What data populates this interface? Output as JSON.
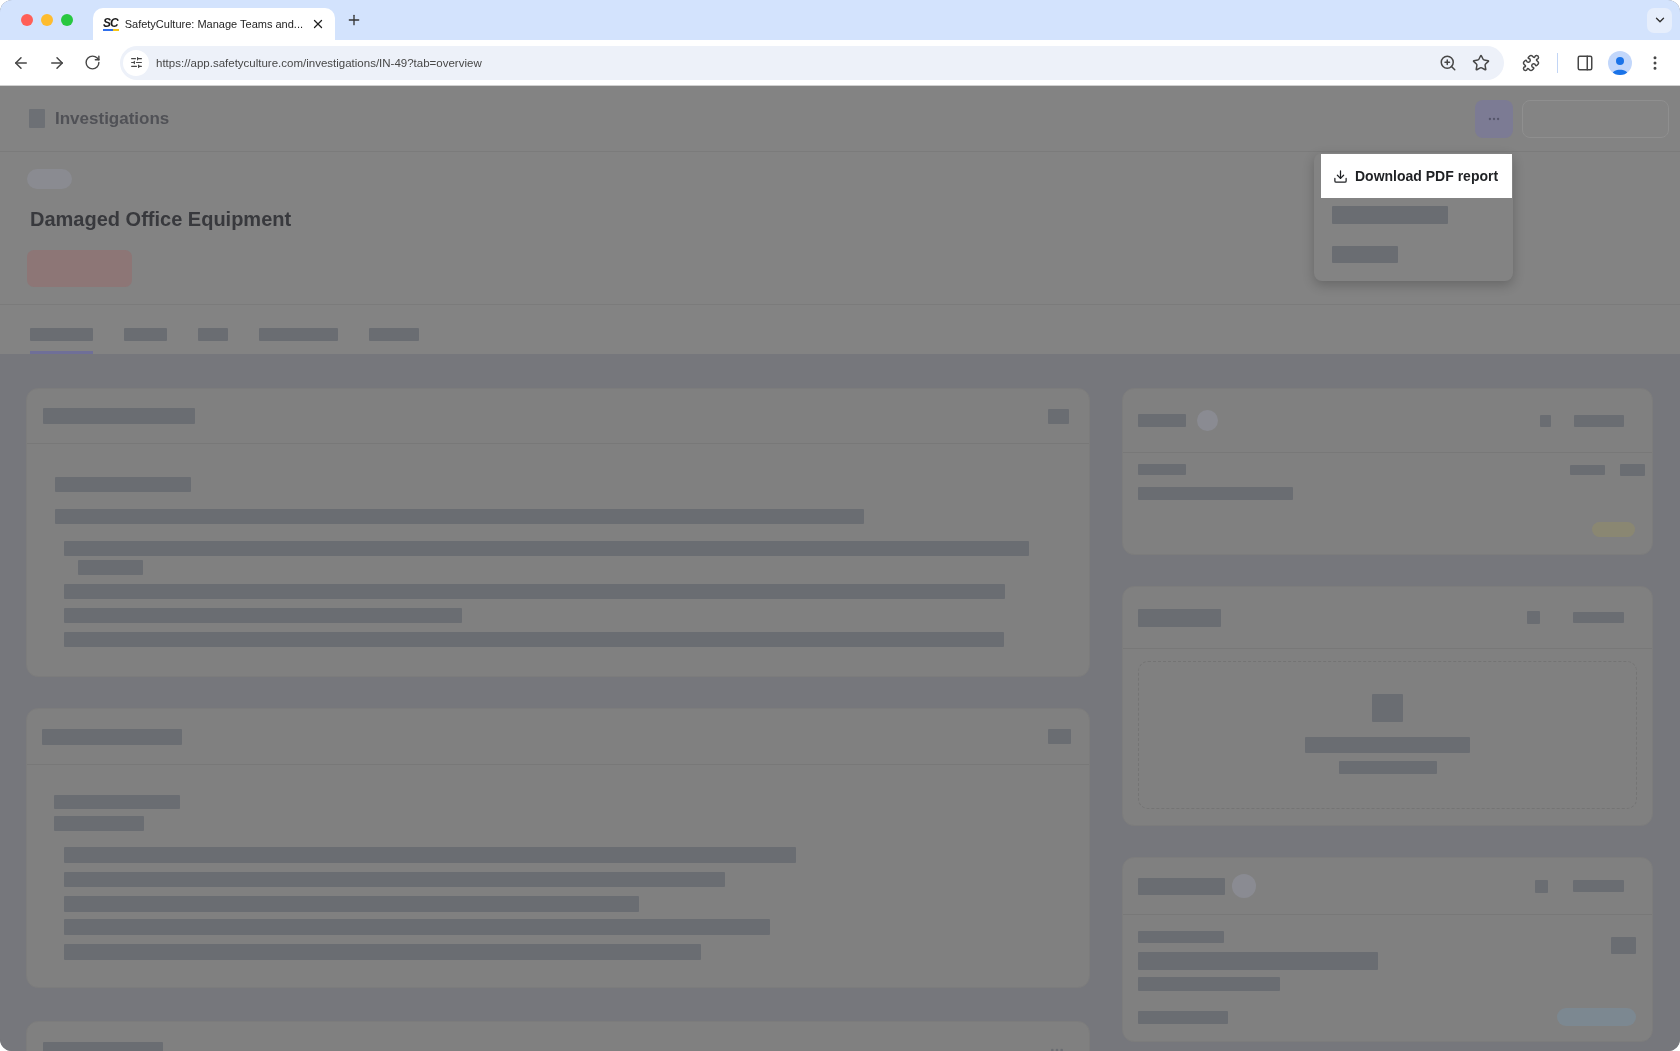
{
  "browser": {
    "tabs": [
      {
        "logo": "SC",
        "title": "SafetyCulture: Manage Teams and...",
        "selected": true
      }
    ],
    "url": "https://app.safetyculture.com/investigations/IN-49?tab=overview"
  },
  "header": {
    "section": "Investigations"
  },
  "investigation": {
    "title": "Damaged Office Equipment"
  },
  "page_tabs": [
    {
      "selected": true
    },
    {
      "selected": false
    },
    {
      "selected": false
    },
    {
      "selected": false
    },
    {
      "selected": false
    }
  ],
  "menu": {
    "items": [
      {
        "label": "Download PDF report",
        "highlighted": true
      }
    ]
  }
}
